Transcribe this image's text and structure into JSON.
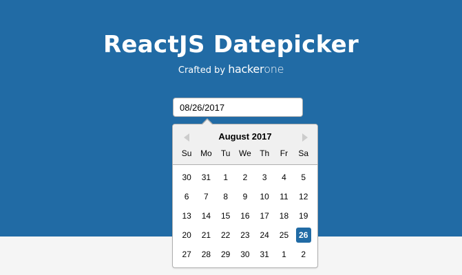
{
  "hero": {
    "title": "ReactJS Datepicker",
    "crafted_prefix": "Crafted by",
    "brand_h": "hacker",
    "brand_rest": "one",
    "background_color": "#216ba5"
  },
  "date_input": {
    "value": "08/26/2017"
  },
  "calendar": {
    "month_label": "August 2017",
    "prev_icon": "triangle-left-icon",
    "next_icon": "triangle-right-icon",
    "weekdays": [
      "Su",
      "Mo",
      "Tu",
      "We",
      "Th",
      "Fr",
      "Sa"
    ],
    "weeks": [
      [
        "30",
        "31",
        "1",
        "2",
        "3",
        "4",
        "5"
      ],
      [
        "6",
        "7",
        "8",
        "9",
        "10",
        "11",
        "12"
      ],
      [
        "13",
        "14",
        "15",
        "16",
        "17",
        "18",
        "19"
      ],
      [
        "20",
        "21",
        "22",
        "23",
        "24",
        "25",
        "26"
      ],
      [
        "27",
        "28",
        "29",
        "30",
        "31",
        "1",
        "2"
      ]
    ],
    "selected_day": "26",
    "selected_color": "#216ba5"
  }
}
